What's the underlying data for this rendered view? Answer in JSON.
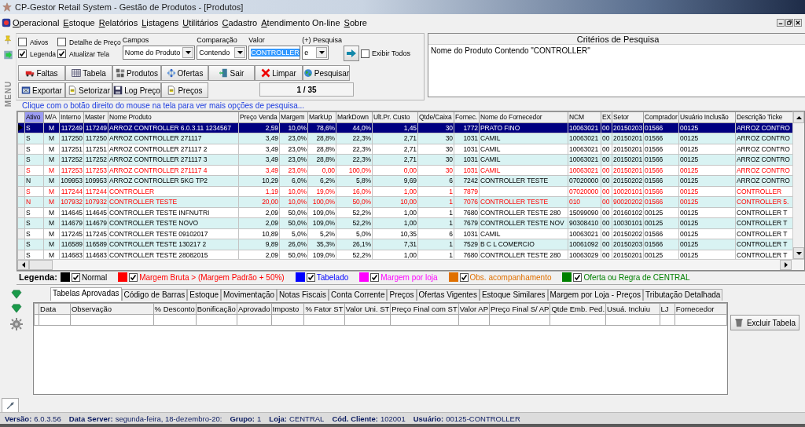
{
  "window": {
    "title": "CP-Gestor Retail System - Gestão de Produtos - [Produtos]"
  },
  "menu": [
    "Operacional",
    "Estoque",
    "Relatórios",
    "Listagens",
    "Utilitários",
    "Cadastro",
    "Atendimento On-line",
    "Sobre"
  ],
  "side_label": "MENU",
  "search": {
    "checkboxes": [
      {
        "label": "Ativos",
        "checked": false
      },
      {
        "label": "Legenda",
        "checked": true
      },
      {
        "label": "Detalhe de Preço",
        "checked": false
      },
      {
        "label": "Atualizar Tela",
        "checked": true
      }
    ],
    "fields": {
      "campos_label": "Campos",
      "campos": "Nome do Produto",
      "comparacao_label": "Comparação",
      "comparacao": "Contendo",
      "valor_label": "Valor",
      "valor": "CONTROLLER",
      "pesquisa_label": "(+) Pesquisa",
      "pesquisa": "e"
    },
    "exibir_todos": {
      "label": "Exibir Todos",
      "checked": false
    },
    "button_rows": [
      [
        "Faltas",
        "Tabela",
        "Produtos",
        "Ofertas",
        "Sair",
        "Limpar",
        "Pesquisar"
      ],
      [
        "Exportar",
        "Setorizar",
        "Log Preço",
        "Preços"
      ]
    ],
    "record_counter": "1 / 35"
  },
  "criteria": {
    "title": "Critérios de Pesquisa",
    "text": "Nome do Produto Contendo \"CONTROLLER\""
  },
  "hint": "Clique com o botão direito do mouse na tela para ver mais opções de pesquisa...",
  "table": {
    "columns": [
      {
        "label": "Ativo",
        "sorted": true
      },
      {
        "label": "M/A",
        "sorted": false
      },
      {
        "label": "Interno",
        "sorted": false
      },
      {
        "label": "Master",
        "sorted": false
      },
      {
        "label": "Nome Produto",
        "sorted": false
      },
      {
        "label": "Preço Venda",
        "sorted": false
      },
      {
        "label": "Margem",
        "sorted": false
      },
      {
        "label": "MarkUp",
        "sorted": false
      },
      {
        "label": "MarkDown",
        "sorted": false
      },
      {
        "label": "Ult.Pr. Custo",
        "sorted": false
      },
      {
        "label": "Qtde/Caixa",
        "sorted": false
      },
      {
        "label": "Fornec.",
        "sorted": false
      },
      {
        "label": "Nome do Fornecedor",
        "sorted": false
      },
      {
        "label": "NCM",
        "sorted": false
      },
      {
        "label": "EX",
        "sorted": false
      },
      {
        "label": "Setor",
        "sorted": false
      },
      {
        "label": "Comprador",
        "sorted": false
      },
      {
        "label": "Usuário Inclusão",
        "sorted": false
      },
      {
        "label": "Descrição Ticke",
        "sorted": false
      }
    ],
    "rows": [
      {
        "selected": true,
        "kind": "normal",
        "cells": [
          "S",
          "M",
          "117249",
          "117249",
          "ARROZ  CONTROLLER 6.0.3.11 1234567",
          "2,59",
          "10,0%",
          "78,6%",
          "44,0%",
          "1,45",
          "30",
          "1772",
          "PRATO FINO",
          "10063021",
          "00",
          "20150203",
          "01566",
          "00125",
          "ARROZ  CONTRO"
        ]
      },
      {
        "selected": false,
        "kind": "normal",
        "cells": [
          "S",
          "M",
          "117250",
          "117250",
          "ARROZ CONTROLLER 271117",
          "3,49",
          "23,0%",
          "28,8%",
          "22,3%",
          "2,71",
          "30",
          "1031",
          "CAMIL",
          "10063021",
          "00",
          "20150201",
          "01566",
          "00125",
          "ARROZ CONTRO"
        ]
      },
      {
        "selected": false,
        "kind": "normal",
        "cells": [
          "S",
          "M",
          "117251",
          "117251",
          "ARROZ CONTROLLER 271117 2",
          "3,49",
          "23,0%",
          "28,8%",
          "22,3%",
          "2,71",
          "30",
          "1031",
          "CAMIL",
          "10063021",
          "00",
          "20150201",
          "01566",
          "00125",
          "ARROZ CONTRO"
        ]
      },
      {
        "selected": false,
        "kind": "normal",
        "cells": [
          "S",
          "M",
          "117252",
          "117252",
          "ARROZ CONTROLLER 271117 3",
          "3,49",
          "23,0%",
          "28,8%",
          "22,3%",
          "2,71",
          "30",
          "1031",
          "CAMIL",
          "10063021",
          "00",
          "20150201",
          "01566",
          "00125",
          "ARROZ CONTRO"
        ]
      },
      {
        "selected": false,
        "kind": "high_margin",
        "cells": [
          "S",
          "M",
          "117253",
          "117253",
          "ARROZ CONTROLLER 271117 4",
          "3,49",
          "23,0%",
          "0,00",
          "100,0%",
          "0,00",
          "30",
          "1031",
          "CAMIL",
          "10063021",
          "00",
          "20150201",
          "01566",
          "00125",
          "ARROZ CONTRO"
        ]
      },
      {
        "selected": false,
        "kind": "normal",
        "cells": [
          "N",
          "M",
          "109953",
          "109953",
          "ARROZ CONTROLLER 5KG TP2",
          "10,29",
          "6,0%",
          "6,2%",
          "5,8%",
          "9,69",
          "6",
          "7242",
          "CONTROLLER TESTE",
          "07020000",
          "00",
          "20150202",
          "01566",
          "00125",
          "ARROZ CONTRO"
        ]
      },
      {
        "selected": false,
        "kind": "high_margin",
        "cells": [
          "S",
          "M",
          "117244",
          "117244",
          "CONTROLLER",
          "1,19",
          "10,0%",
          "19,0%",
          "16,0%",
          "1,00",
          "1",
          "7879",
          null,
          "07020000",
          "00",
          "10020101",
          "01566",
          "00125",
          "CONTROLLER"
        ]
      },
      {
        "selected": false,
        "kind": "high_margin",
        "cells": [
          "N",
          "M",
          "107932",
          "107932",
          "CONTROLLER TESTE",
          "20,00",
          "10,0%",
          "100,0%",
          "50,0%",
          "10,00",
          "1",
          "7076",
          "CONTROLLER TESTE",
          "010",
          "00",
          "90020202",
          "01566",
          "00125",
          "CONTROLLER 5."
        ]
      },
      {
        "selected": false,
        "kind": "normal",
        "cells": [
          "S",
          "M",
          "114645",
          "114645",
          "CONTROLLER TESTE INFNUTRI",
          "2,09",
          "50,0%",
          "109,0%",
          "52,2%",
          "1,00",
          "1",
          "7680",
          "CONTROLLER TESTE 280",
          "15099090",
          "00",
          "20160102",
          "00125",
          "00125",
          "CONTROLLER T"
        ]
      },
      {
        "selected": false,
        "kind": "normal",
        "cells": [
          "S",
          "M",
          "114679",
          "114679",
          "CONTROLLER TESTE NOVO",
          "2,09",
          "50,0%",
          "109,0%",
          "52,2%",
          "1,00",
          "1",
          "7679",
          "CONTROLLER TESTE NOV",
          "90308410",
          "00",
          "10030101",
          "00125",
          "00125",
          "CONTROLLER T"
        ]
      },
      {
        "selected": false,
        "kind": "normal",
        "cells": [
          "S",
          "M",
          "117245",
          "117245",
          "CONTROLLER TESTE 09102017",
          "10,89",
          "5,0%",
          "5,2%",
          "5,0%",
          "10,35",
          "6",
          "1031",
          "CAMIL",
          "10063021",
          "00",
          "20150202",
          "01566",
          "00125",
          "CONTROLLER T"
        ]
      },
      {
        "selected": false,
        "kind": "normal",
        "cells": [
          "S",
          "M",
          "116589",
          "116589",
          "CONTROLLER TESTE 130217 2",
          "9,89",
          "26,0%",
          "35,3%",
          "26,1%",
          "7,31",
          "1",
          "7529",
          "B C L COMERCIO",
          "10061092",
          "00",
          "20150203",
          "01566",
          "00125",
          "CONTROLLER T"
        ]
      },
      {
        "selected": false,
        "kind": "normal",
        "cells": [
          "S",
          "M",
          "114683",
          "114683",
          "CONTROLLER TESTE 28082015",
          "2,09",
          "50,0%",
          "109,0%",
          "52,2%",
          "1,00",
          "1",
          "7680",
          "CONTROLLER TESTE 280",
          "10063029",
          "00",
          "20150201",
          "00125",
          "00125",
          "CONTROLLER T"
        ]
      }
    ]
  },
  "legend": {
    "title": "Legenda:",
    "items": [
      {
        "label": "Normal",
        "color": "#000000",
        "checked": true
      },
      {
        "label": "Margem Bruta > (Margem Padrão + 50%)",
        "color": "#ff0000",
        "checked": true
      },
      {
        "label": "Tabelado",
        "color": "#0000ff",
        "checked": true
      },
      {
        "label": "Margem por loja",
        "color": "#ff00ff",
        "checked": true
      },
      {
        "label": "Obs. acompanhamento",
        "color": "#e07000",
        "checked": true
      },
      {
        "label": "Oferta ou Regra de CENTRAL",
        "color": "#008000",
        "checked": true
      }
    ]
  },
  "detail": {
    "tabs": [
      {
        "label": "Tabelas Aprovadas",
        "selected": true
      },
      {
        "label": "Código de Barras",
        "selected": false
      },
      {
        "label": "Estoque",
        "selected": false
      },
      {
        "label": "Movimentação",
        "selected": false
      },
      {
        "label": "Notas Fiscais",
        "selected": false
      },
      {
        "label": "Conta Corrente",
        "selected": false
      },
      {
        "label": "Preços",
        "selected": false
      },
      {
        "label": "Ofertas Vigentes",
        "selected": false
      },
      {
        "label": "Estoque Similares",
        "selected": false
      },
      {
        "label": "Margem por Loja - Preços",
        "selected": false
      },
      {
        "label": "Tributação Detalhada",
        "selected": false
      }
    ],
    "columns": [
      "Data",
      "Observação",
      "% Desconto",
      "Bonificação",
      "Aprovado",
      "Imposto",
      "% Fator ST",
      "Valor Uni. ST",
      "Preço Final com ST",
      "Valor AP",
      "Preço Final S/ AP",
      "Qtde Emb. Ped.",
      "Usuá. Incluiu",
      "LJ",
      "Fornecedor"
    ],
    "button": "Excluir Tabela"
  },
  "status_bar": [
    {
      "label": "Versão:",
      "value": "6.0.3.56"
    },
    {
      "label": "Data Server:",
      "value": "segunda-feira, 18-dezembro-20:"
    },
    {
      "label": "Grupo:",
      "value": "1"
    },
    {
      "label": "Loja:",
      "value": "CENTRAL"
    },
    {
      "label": "Cód. Cliente:",
      "value": "102001"
    },
    {
      "label": "Usuário:",
      "value": "00125-CONTROLLER"
    }
  ]
}
